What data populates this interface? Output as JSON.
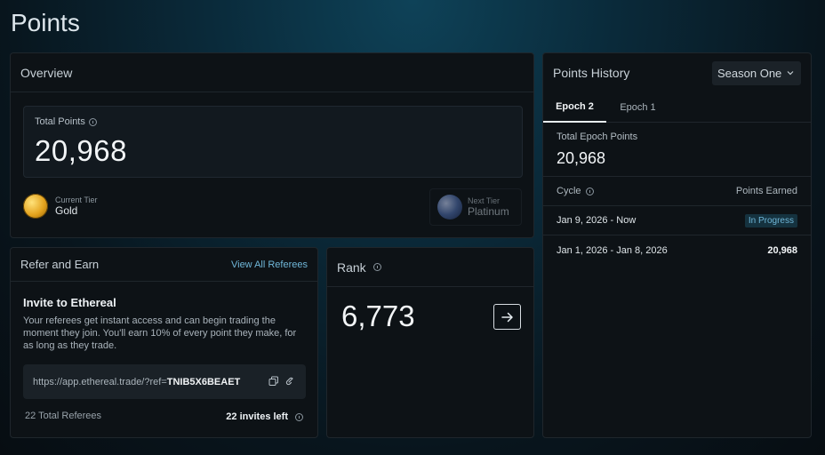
{
  "page": {
    "title": "Points"
  },
  "overview": {
    "title": "Overview",
    "total_label": "Total Points",
    "total_value": "20,968",
    "current_tier_label": "Current Tier",
    "current_tier": "Gold",
    "next_tier_label": "Next Tier",
    "next_tier": "Platinum"
  },
  "refer": {
    "title": "Refer and Earn",
    "view_all": "View All Referees",
    "invite_title": "Invite to Ethereal",
    "invite_desc": "Your referees get instant access and can begin trading the moment they join. You'll earn 10% of every point they make, for as long as they trade.",
    "link_prefix": "https://app.ethereal.trade/?ref=",
    "link_code": "TNIB5X6BEAET",
    "total_referees": "22 Total Referees",
    "invites_left": "22 invites left"
  },
  "rank": {
    "title": "Rank",
    "value": "6,773"
  },
  "history": {
    "title": "Points History",
    "season": "Season One",
    "tabs": [
      "Epoch 2",
      "Epoch 1"
    ],
    "epoch_label": "Total Epoch Points",
    "epoch_value": "20,968",
    "col_cycle": "Cycle",
    "col_points": "Points Earned",
    "rows": [
      {
        "cycle": "Jan 9, 2026 - Now",
        "status": "In Progress"
      },
      {
        "cycle": "Jan 1, 2026 - Jan 8, 2026",
        "points": "20,968"
      }
    ]
  },
  "colors": {
    "accent": "#6fb6d8",
    "card": "#0d1216",
    "border": "#1f262c"
  }
}
